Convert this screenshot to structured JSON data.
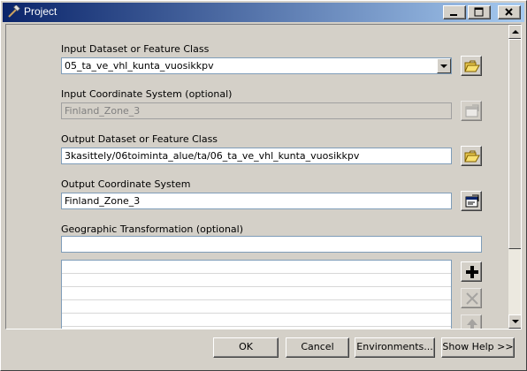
{
  "window": {
    "title": "Project"
  },
  "form": {
    "input_dataset": {
      "label": "Input Dataset or Feature Class",
      "value": "05_ta_ve_vhl_kunta_vuosikkpv"
    },
    "input_cs": {
      "label": "Input Coordinate System (optional)",
      "value": "Finland_Zone_3"
    },
    "output_dataset": {
      "label": "Output Dataset or Feature Class",
      "value": "3kasittely/06toiminta_alue/ta/06_ta_ve_vhl_kunta_vuosikkpv"
    },
    "output_cs": {
      "label": "Output Coordinate System",
      "value": "Finland_Zone_3"
    },
    "geo_transform": {
      "label": "Geographic Transformation (optional)",
      "value": ""
    }
  },
  "buttons": {
    "ok": "OK",
    "cancel": "Cancel",
    "environments": "Environments...",
    "show_help": "Show Help >>"
  },
  "colors": {
    "title_start": "#0a246a",
    "title_end": "#a6caf0",
    "face": "#d4d0c8"
  }
}
